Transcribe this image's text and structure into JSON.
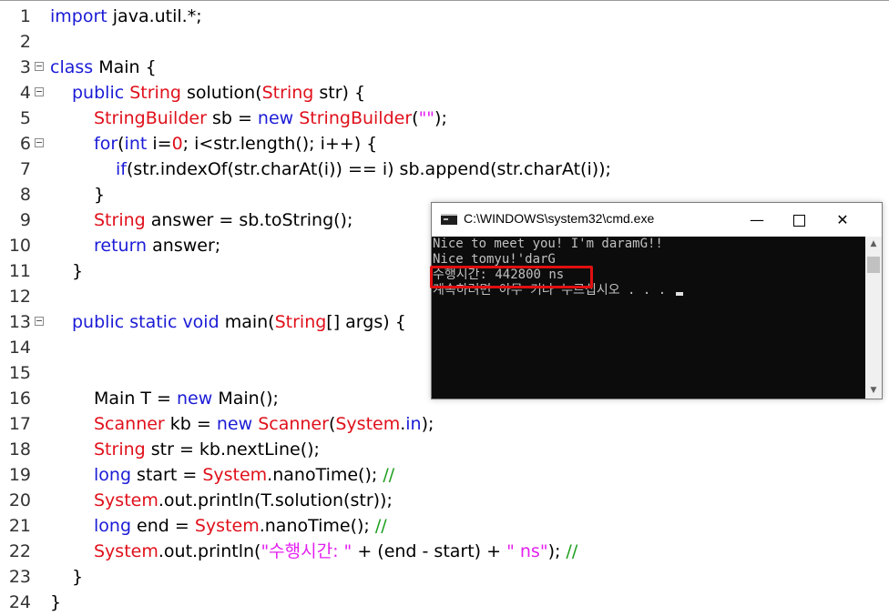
{
  "editor": {
    "lines": [
      {
        "num": "1",
        "code": "<span class=\"kw\">import</span> java.util.*;",
        "fold": false
      },
      {
        "num": "2",
        "code": "",
        "fold": false
      },
      {
        "num": "3",
        "code": "<span class=\"kw\">class</span> Main {",
        "fold": true
      },
      {
        "num": "4",
        "code": "<span class=\"in1\"></span><span class=\"kw\">public</span> <span class=\"ty\">String</span> solution(<span class=\"ty\">String</span> str) {",
        "fold": true
      },
      {
        "num": "5",
        "code": "<span class=\"in2\"></span><span class=\"ty\">StringBuilder</span> sb = <span class=\"kw\">new</span> <span class=\"ty\">StringBuilder</span>(<span class=\"str\">\"\"</span>);",
        "fold": false
      },
      {
        "num": "6",
        "code": "<span class=\"in2\"></span><span class=\"kw\">for</span>(<span class=\"kw\">int</span> i=<span class=\"num\">0</span>; i&lt;str.length(); i++) {",
        "fold": true
      },
      {
        "num": "7",
        "code": "<span class=\"in3\"></span><span class=\"kw\">if</span>(str.indexOf(str.charAt(i)) == i) sb.append(str.charAt(i));",
        "fold": false
      },
      {
        "num": "8",
        "code": "<span class=\"in2\"></span>}",
        "fold": false
      },
      {
        "num": "9",
        "code": "<span class=\"in2\"></span><span class=\"ty\">String</span> answer = sb.toString();",
        "fold": false
      },
      {
        "num": "10",
        "code": "<span class=\"in2\"></span><span class=\"kw\">return</span> answer;",
        "fold": false
      },
      {
        "num": "11",
        "code": "<span class=\"in1\"></span>}",
        "fold": false
      },
      {
        "num": "12",
        "code": "",
        "fold": false
      },
      {
        "num": "13",
        "code": "<span class=\"in1\"></span><span class=\"kw\">public</span> <span class=\"kw\">static</span> <span class=\"kw\">void</span> main(<span class=\"ty\">String</span>[] args) {",
        "fold": true
      },
      {
        "num": "14",
        "code": "",
        "fold": false
      },
      {
        "num": "15",
        "code": "",
        "fold": false
      },
      {
        "num": "16",
        "code": "<span class=\"in2\"></span>Main T = <span class=\"kw\">new</span> Main();",
        "fold": false
      },
      {
        "num": "17",
        "code": "<span class=\"in2\"></span><span class=\"ty\">Scanner</span> kb = <span class=\"kw\">new</span> <span class=\"ty\">Scanner</span>(<span class=\"ty\">System</span>.<span class=\"kw\">in</span>);",
        "fold": false
      },
      {
        "num": "18",
        "code": "<span class=\"in2\"></span><span class=\"ty\">String</span> str = kb.nextLine();",
        "fold": false
      },
      {
        "num": "19",
        "code": "<span class=\"in2\"></span><span class=\"kw\">long</span> start = <span class=\"ty\">System</span>.nanoTime(); <span class=\"cm\">//</span>",
        "fold": false
      },
      {
        "num": "20",
        "code": "<span class=\"in2\"></span><span class=\"ty\">System</span>.out.println(T.solution(str));",
        "fold": false
      },
      {
        "num": "21",
        "code": "<span class=\"in2\"></span><span class=\"kw\">long</span> end = <span class=\"ty\">System</span>.nanoTime(); <span class=\"cm\">//</span>",
        "fold": false
      },
      {
        "num": "22",
        "code": "<span class=\"in2\"></span><span class=\"ty\">System</span>.out.println(<span class=\"str\">\"수행시간: \"</span> + (end - start) + <span class=\"str\">\" ns\"</span>); <span class=\"cm\">//</span>",
        "fold": false
      },
      {
        "num": "23",
        "code": "<span class=\"in1\"></span>}",
        "fold": false
      },
      {
        "num": "24",
        "code": "}",
        "fold": false
      }
    ]
  },
  "console": {
    "title": "C:\\WINDOWS\\system32\\cmd.exe",
    "minimize": "—",
    "close": "✕",
    "lines": [
      "Nice to meet you! I'm daramG!!",
      "Nice tomyu!'darG",
      "수행시간: 442800 ns",
      "계속하려면 아무 키나 누르십시오 . . . "
    ],
    "scroll_up": "▲",
    "scroll_down": "▼"
  }
}
